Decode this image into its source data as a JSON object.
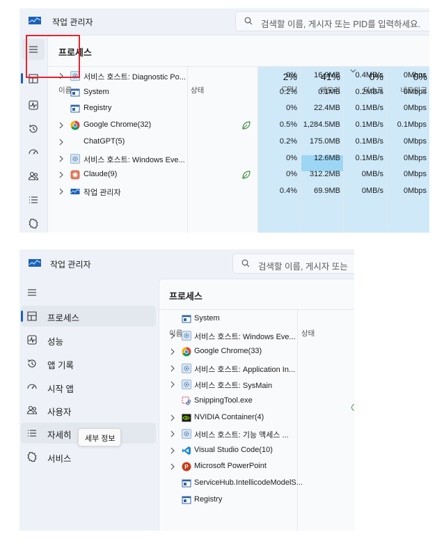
{
  "top": {
    "app_title": "작업 관리자",
    "search_placeholder": "검색할 이름, 게시자 또는 PID를 입력하세요.",
    "page_title": "프로세스",
    "col_name": "이름",
    "col_status": "상태",
    "cpu_pct": "2%",
    "cpu_label": "CPU",
    "mem_pct": "41%",
    "mem_label": "메모리",
    "disk_pct": "0%",
    "disk_label": "디스크",
    "net_pct": "0%",
    "net_label": "네트워크",
    "rows": [
      {
        "name": "서비스 호스트: Diagnostic Po...",
        "icon": "gear-service-icon",
        "expand": true,
        "eco": false,
        "cpu": "0%",
        "mem": "16.9MB",
        "disk": "0.4MB/s",
        "net": "0Mbps"
      },
      {
        "name": "System",
        "icon": "window-icon",
        "expand": false,
        "eco": false,
        "cpu": "0.2%",
        "mem": "0.1MB",
        "disk": "0.2MB/s",
        "net": "0Mbps"
      },
      {
        "name": "Registry",
        "icon": "window-icon",
        "expand": false,
        "eco": false,
        "cpu": "0%",
        "mem": "22.4MB",
        "disk": "0.1MB/s",
        "net": "0Mbps"
      },
      {
        "name": "Google Chrome(32)",
        "icon": "chrome-icon",
        "expand": true,
        "eco": true,
        "cpu": "0.5%",
        "mem": "1,284.5MB",
        "disk": "0.1MB/s",
        "net": "0.1Mbps"
      },
      {
        "name": "ChatGPT(5)",
        "icon": "none",
        "expand": true,
        "eco": false,
        "cpu": "0.2%",
        "mem": "175.0MB",
        "disk": "0.1MB/s",
        "net": "0Mbps"
      },
      {
        "name": "서비스 호스트: Windows Eve...",
        "icon": "gear-service-icon",
        "expand": true,
        "eco": false,
        "cpu": "0%",
        "mem": "12.6MB",
        "disk": "0.1MB/s",
        "net": "0Mbps"
      },
      {
        "name": "Claude(9)",
        "icon": "claude-icon",
        "expand": true,
        "eco": true,
        "cpu": "0%",
        "mem": "312.2MB",
        "disk": "0MB/s",
        "net": "0Mbps"
      },
      {
        "name": "작업 관리자",
        "icon": "taskmgr-icon",
        "expand": true,
        "eco": false,
        "cpu": "0.4%",
        "mem": "69.9MB",
        "disk": "0MB/s",
        "net": "0Mbps"
      }
    ]
  },
  "bottom": {
    "app_title": "작업 관리자",
    "search_placeholder": "검색할 이름, 게시자 또는",
    "page_title": "프로세스",
    "col_name": "이름",
    "col_status": "상태",
    "nav": [
      {
        "label": "프로세스",
        "icon": "processes-icon"
      },
      {
        "label": "성능",
        "icon": "performance-icon"
      },
      {
        "label": "앱 기록",
        "icon": "app-history-icon"
      },
      {
        "label": "시작 앱",
        "icon": "startup-icon"
      },
      {
        "label": "사용자",
        "icon": "users-icon"
      },
      {
        "label": "자세히",
        "icon": "details-icon"
      },
      {
        "label": "서비스",
        "icon": "services-icon"
      }
    ],
    "tooltip": "세부 정보",
    "rows": [
      {
        "name": "System",
        "icon": "window-icon",
        "expand": false
      },
      {
        "name": "서비스 호스트: Windows Eve...",
        "icon": "gear-service-icon",
        "expand": true
      },
      {
        "name": "Google Chrome(33)",
        "icon": "chrome-icon",
        "expand": true
      },
      {
        "name": "서비스 호스트: Application In...",
        "icon": "gear-service-icon",
        "expand": true
      },
      {
        "name": "서비스 호스트: SysMain",
        "icon": "gear-service-icon",
        "expand": true
      },
      {
        "name": "SnippingTool.exe",
        "icon": "snipping-icon",
        "expand": false
      },
      {
        "name": "NVIDIA Container(4)",
        "icon": "nvidia-icon",
        "expand": true
      },
      {
        "name": "서비스 호스트: 기능 액세스 ...",
        "icon": "gear-service-icon",
        "expand": true
      },
      {
        "name": "Visual Studio Code(10)",
        "icon": "vscode-icon",
        "expand": true
      },
      {
        "name": "Microsoft PowerPoint",
        "icon": "powerpoint-icon",
        "expand": true
      },
      {
        "name": "ServiceHub.IntellicodeModelS...",
        "icon": "window-icon",
        "expand": false
      },
      {
        "name": "Registry",
        "icon": "window-icon",
        "expand": false
      }
    ]
  },
  "colors": {
    "accent": "#1e5fb5",
    "highlight_box": "#e8222a",
    "metric_bg": "#cfe9f8",
    "metric_hot": "#9dd6f4",
    "eco_green": "#3a8f3a"
  }
}
